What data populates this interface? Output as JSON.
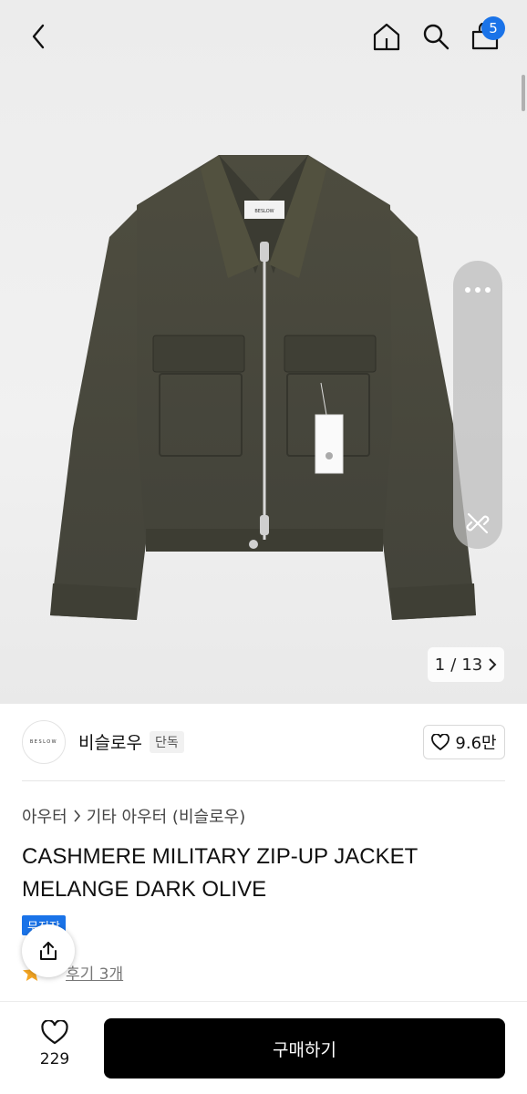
{
  "topbar": {
    "cart_count": "5"
  },
  "hero": {
    "pager_current": "1",
    "pager_sep": "/",
    "pager_total": "13",
    "jacket_label": "BESLOW"
  },
  "brand": {
    "logo_text": "BESLOW",
    "name": "비슬로우",
    "tag": "단독",
    "likes": "9.6만"
  },
  "category": {
    "parent": "아우터",
    "child": "기타 아우터 (비슬로우)"
  },
  "product": {
    "title": "CASHMERE MILITARY ZIP-UP JACKET MELANGE DARK OLIVE",
    "badge": "무진장",
    "review_text": "후기 3개"
  },
  "bottom": {
    "wish_count": "229",
    "buy_label": "구매하기"
  },
  "colors": {
    "accent": "#1a73e8",
    "jacket": "#4a4a3c"
  }
}
